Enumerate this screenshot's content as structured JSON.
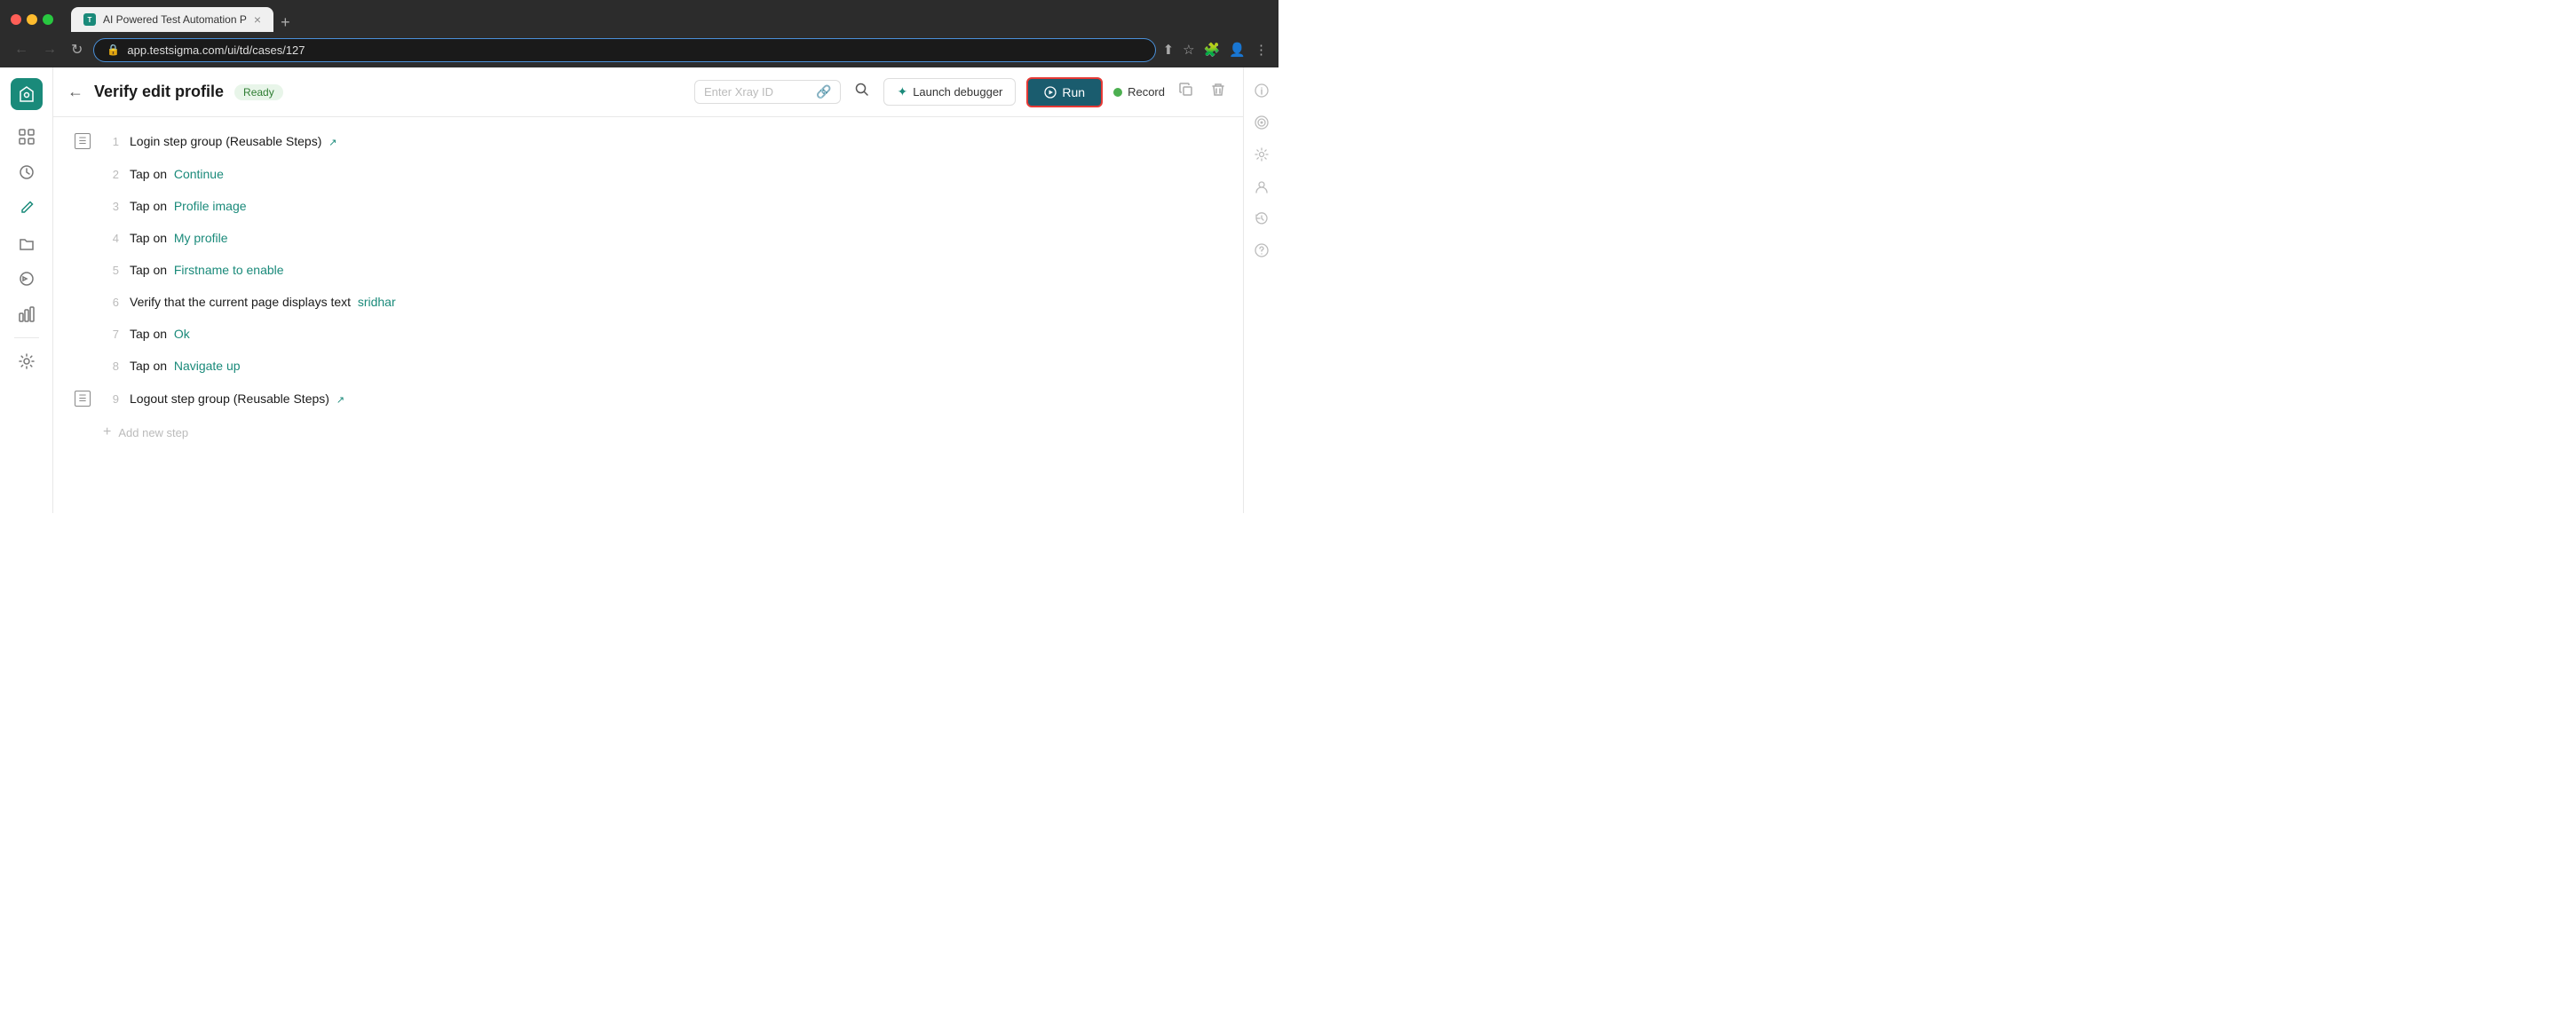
{
  "browser": {
    "tab_title": "AI Powered Test Automation P",
    "url": "app.testsigma.com/ui/td/cases/127",
    "new_tab_icon": "+"
  },
  "toolbar": {
    "back_label": "←",
    "page_title": "Verify edit profile",
    "status": "Ready",
    "xray_placeholder": "Enter Xray ID",
    "debugger_label": "Launch debugger",
    "run_label": "Run",
    "record_label": "Record"
  },
  "steps": [
    {
      "number": "1",
      "type": "group",
      "text": "Login step group (Reusable Steps)",
      "has_external": true
    },
    {
      "number": "2",
      "type": "action",
      "prefix": "Tap on",
      "value": "Continue"
    },
    {
      "number": "3",
      "type": "action",
      "prefix": "Tap on",
      "value": "Profile image"
    },
    {
      "number": "4",
      "type": "action",
      "prefix": "Tap on",
      "value": "My profile"
    },
    {
      "number": "5",
      "type": "action",
      "prefix": "Tap on",
      "value": "Firstname to enable"
    },
    {
      "number": "6",
      "type": "action",
      "prefix": "Verify that the current page displays text",
      "value": "sridhar"
    },
    {
      "number": "7",
      "type": "action",
      "prefix": "Tap on",
      "value": "Ok"
    },
    {
      "number": "8",
      "type": "action",
      "prefix": "Tap on",
      "value": "Navigate up"
    },
    {
      "number": "9",
      "type": "group",
      "text": "Logout step group (Reusable Steps)",
      "has_external": true
    }
  ],
  "add_step_label": "Add new step",
  "sidebar": {
    "items": [
      {
        "icon": "⊞",
        "name": "dashboard"
      },
      {
        "icon": "◎",
        "name": "test-cases"
      },
      {
        "icon": "✏",
        "name": "editor"
      },
      {
        "icon": "▭",
        "name": "suites"
      },
      {
        "icon": "↻",
        "name": "runs"
      },
      {
        "icon": "▦",
        "name": "applications"
      },
      {
        "icon": "⚙",
        "name": "settings"
      }
    ]
  },
  "right_sidebar": {
    "items": [
      {
        "icon": "ℹ",
        "name": "info"
      },
      {
        "icon": "◎",
        "name": "target"
      },
      {
        "icon": "⚙",
        "name": "settings"
      },
      {
        "icon": "☺",
        "name": "user"
      },
      {
        "icon": "↺",
        "name": "history"
      },
      {
        "icon": "?",
        "name": "help"
      }
    ]
  },
  "colors": {
    "accent": "#1a8a7a",
    "run_bg": "#1a5c6e",
    "record_dot": "#4caf50",
    "run_border": "#e53935"
  }
}
